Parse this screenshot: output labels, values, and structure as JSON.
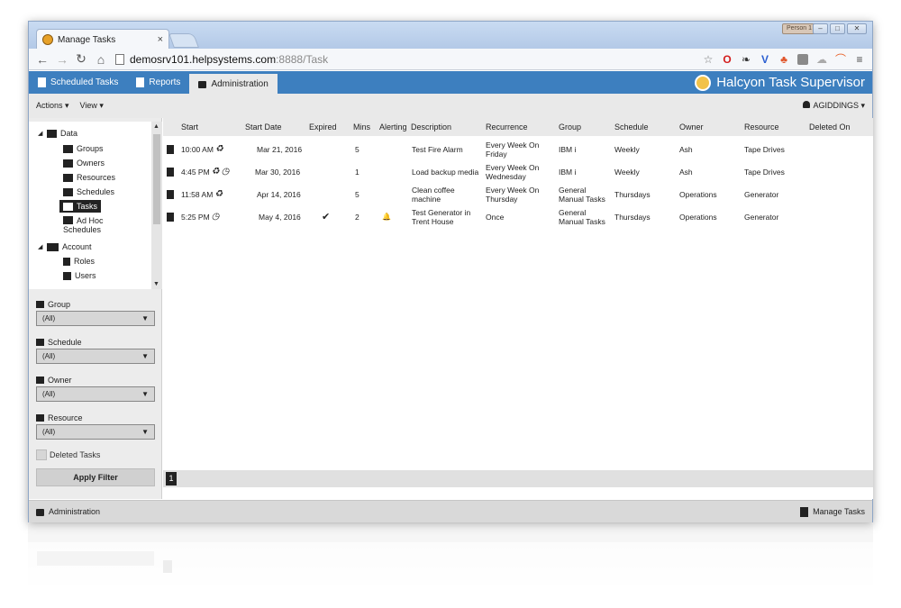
{
  "browser": {
    "tab_title": "Manage Tasks",
    "tab_close": "×",
    "person_badge": "Person 1",
    "url_host": "demosrv101.helpsystems.com",
    "url_path": ":8888/Task"
  },
  "appnav": {
    "tabs": [
      {
        "label": "Scheduled Tasks"
      },
      {
        "label": "Reports"
      },
      {
        "label": "Administration"
      }
    ],
    "brand": "Halcyon Task Supervisor"
  },
  "toolbar": {
    "actions": "Actions ▾",
    "view": "View ▾",
    "user": "AGIDDINGS ▾"
  },
  "tree": {
    "data": "Data",
    "groups": "Groups",
    "owners": "Owners",
    "resources": "Resources",
    "schedules": "Schedules",
    "tasks": "Tasks",
    "adhoc1": "Ad Hoc",
    "adhoc2": "Schedules",
    "account": "Account",
    "roles": "Roles",
    "users": "Users"
  },
  "filters": {
    "group_label": "Group",
    "group_value": "(All)",
    "schedule_label": "Schedule",
    "schedule_value": "(All)",
    "owner_label": "Owner",
    "owner_value": "(All)",
    "resource_label": "Resource",
    "resource_value": "(All)",
    "deleted_label": "Deleted Tasks",
    "apply": "Apply Filter"
  },
  "grid": {
    "columns": [
      "Start",
      "Start Date",
      "Expired",
      "Mins",
      "Alerting",
      "Description",
      "Recurrence",
      "Group",
      "Schedule",
      "Owner",
      "Resource",
      "Deleted On"
    ],
    "rows": [
      {
        "start": "10:00 AM",
        "date": "Mar 21, 2016",
        "expired": "",
        "mins": "5",
        "alerting": "",
        "desc": "Test Fire Alarm",
        "rec": "Every Week On Friday",
        "group": "IBM i",
        "schedule": "Weekly",
        "owner": "Ash",
        "resource": "Tape Drives",
        "deleted": "",
        "recycle": true,
        "clock": false
      },
      {
        "start": "4:45 PM",
        "date": "Mar 30, 2016",
        "expired": "",
        "mins": "1",
        "alerting": "",
        "desc": "Load backup media",
        "rec": "Every Week On Wednesday",
        "group": "IBM i",
        "schedule": "Weekly",
        "owner": "Ash",
        "resource": "Tape Drives",
        "deleted": "",
        "recycle": true,
        "clock": true
      },
      {
        "start": "11:58 AM",
        "date": "Apr 14, 2016",
        "expired": "",
        "mins": "5",
        "alerting": "",
        "desc": "Clean coffee machine",
        "rec": "Every Week On Thursday",
        "group": "General Manual Tasks",
        "schedule": "Thursdays",
        "owner": "Operations",
        "resource": "Generator",
        "deleted": "",
        "recycle": true,
        "clock": false
      },
      {
        "start": "5:25 PM",
        "date": "May 4, 2016",
        "expired": "✔",
        "mins": "2",
        "alerting": "🔔",
        "desc": "Test Generator in Trent House",
        "rec": "Once",
        "group": "General Manual Tasks",
        "schedule": "Thursdays",
        "owner": "Operations",
        "resource": "Generator",
        "deleted": "",
        "recycle": false,
        "clock": true
      }
    ],
    "page": "1"
  },
  "statusbar": {
    "left": "Administration",
    "right": "Manage Tasks"
  }
}
